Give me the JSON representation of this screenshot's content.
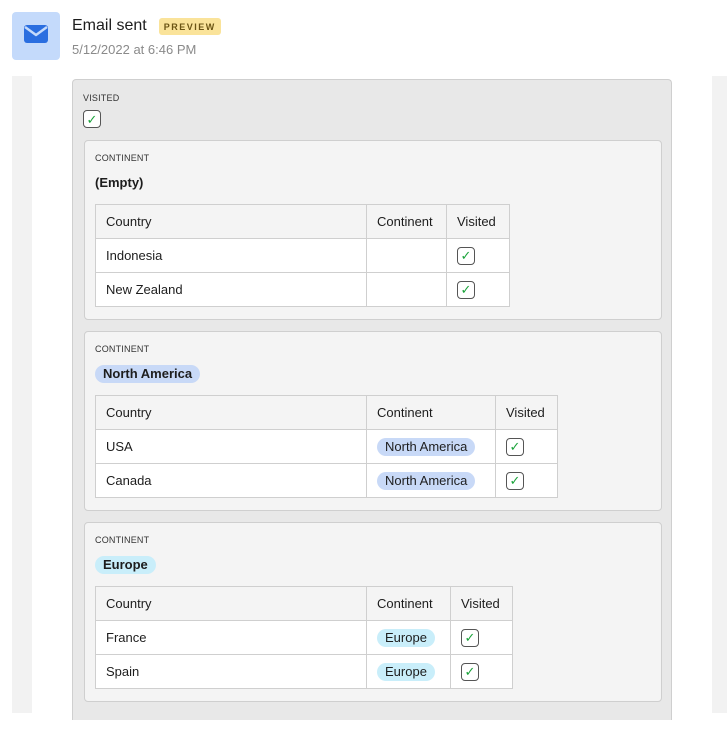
{
  "header": {
    "title": "Email sent",
    "badge": "PREVIEW",
    "timestamp": "5/12/2022 at 6:46 PM",
    "icon": "envelope-icon"
  },
  "colors": {
    "avatar_bg": "#c4dafb",
    "icon_blue": "#2a6ee0",
    "badge_bg": "#fae39a",
    "pill_north_america": "#c8d9f7",
    "pill_europe": "#c9eefa",
    "check_green": "#1aa33a"
  },
  "record": {
    "visited_label": "VISITED",
    "visited_checked": true,
    "groups": [
      {
        "label": "CONTINENT",
        "value": "(Empty)",
        "headers": [
          "Country",
          "Continent",
          "Visited"
        ],
        "rows": [
          {
            "country": "Indonesia",
            "continent": "",
            "visited": true
          },
          {
            "country": "New Zealand",
            "continent": "",
            "visited": true
          }
        ]
      },
      {
        "label": "CONTINENT",
        "value": "North America",
        "headers": [
          "Country",
          "Continent",
          "Visited"
        ],
        "rows": [
          {
            "country": "USA",
            "continent": "North America",
            "visited": true
          },
          {
            "country": "Canada",
            "continent": "North America",
            "visited": true
          }
        ]
      },
      {
        "label": "CONTINENT",
        "value": "Europe",
        "headers": [
          "Country",
          "Continent",
          "Visited"
        ],
        "rows": [
          {
            "country": "France",
            "continent": "Europe",
            "visited": true
          },
          {
            "country": "Spain",
            "continent": "Europe",
            "visited": true
          }
        ]
      }
    ]
  }
}
